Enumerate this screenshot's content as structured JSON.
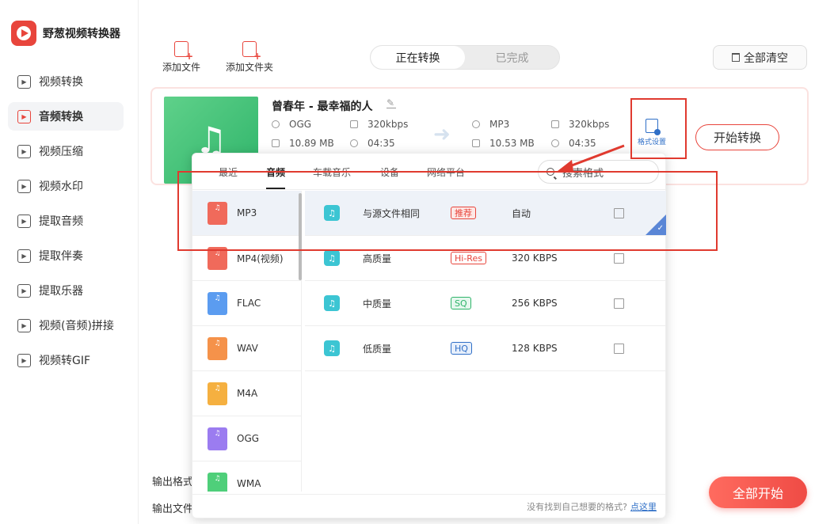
{
  "app": {
    "name": "野葱视频转换器"
  },
  "sidebar": {
    "items": [
      {
        "label": "视频转换",
        "icon": "video-convert-icon",
        "active": false
      },
      {
        "label": "音频转换",
        "icon": "audio-convert-icon",
        "active": true
      },
      {
        "label": "视频压缩",
        "icon": "video-compress-icon",
        "active": false
      },
      {
        "label": "视频水印",
        "icon": "video-watermark-icon",
        "active": false
      },
      {
        "label": "提取音频",
        "icon": "extract-audio-icon",
        "active": false
      },
      {
        "label": "提取伴奏",
        "icon": "extract-accompaniment-icon",
        "active": false
      },
      {
        "label": "提取乐器",
        "icon": "extract-instrument-icon",
        "active": false
      },
      {
        "label": "视频(音频)拼接",
        "icon": "merge-icon",
        "active": false
      },
      {
        "label": "视频转GIF",
        "icon": "gif-icon",
        "active": false
      }
    ]
  },
  "toolbar": {
    "add_file": "添加文件",
    "add_folder": "添加文件夹",
    "tab_converting": "正在转换",
    "tab_done": "已完成",
    "clear_all": "全部清空"
  },
  "file": {
    "title": "曾春年 - 最幸福的人",
    "source": {
      "format": "OGG",
      "bitrate": "320kbps",
      "size": "10.89 MB",
      "duration": "04:35"
    },
    "target": {
      "format": "MP3",
      "bitrate": "320kbps",
      "size": "10.53 MB",
      "duration": "04:35"
    },
    "format_settings": "格式设置",
    "start": "开始转换"
  },
  "popup": {
    "tabs": [
      "最近",
      "音频",
      "车载音乐",
      "设备",
      "网络平台"
    ],
    "active_tab": "音频",
    "search_placeholder": "搜索格式",
    "formats": [
      {
        "name": "MP3",
        "color": "#f06a5b",
        "active": true
      },
      {
        "name": "MP4(视频)",
        "color": "#f06a5b",
        "active": false
      },
      {
        "name": "FLAC",
        "color": "#5b9cf0",
        "active": false
      },
      {
        "name": "WAV",
        "color": "#f5924a",
        "active": false
      },
      {
        "name": "M4A",
        "color": "#f5b040",
        "active": false
      },
      {
        "name": "OGG",
        "color": "#9b7cf0",
        "active": false
      },
      {
        "name": "WMA",
        "color": "#4fcf7a",
        "active": false
      }
    ],
    "qualities": [
      {
        "name": "与源文件相同",
        "badge": "推荐",
        "badge_color": "#e8453c",
        "badge_bg": "#fde8e6",
        "value": "自动",
        "active": true
      },
      {
        "name": "高质量",
        "badge": "Hi-Res",
        "badge_color": "#e8453c",
        "badge_bg": "#fff",
        "value": "320 KBPS",
        "active": false
      },
      {
        "name": "中质量",
        "badge": "SQ",
        "badge_color": "#2fb46a",
        "badge_bg": "#e6f7ee",
        "value": "256 KBPS",
        "active": false
      },
      {
        "name": "低质量",
        "badge": "HQ",
        "badge_color": "#2f6fc7",
        "badge_bg": "#e7effb",
        "value": "128 KBPS",
        "active": false
      }
    ],
    "footer_text": "没有找到自己想要的格式?",
    "footer_link": "点这里"
  },
  "bottom": {
    "output_format_label": "输出格式",
    "output_file_label": "输出文件",
    "start_all": "全部开始"
  }
}
